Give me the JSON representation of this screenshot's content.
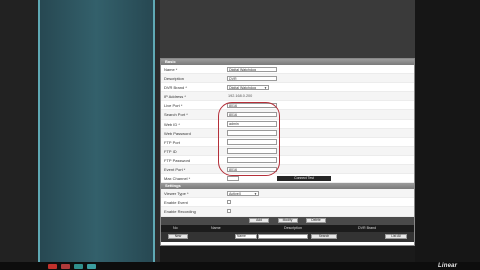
{
  "colors": {
    "sidebar": "#33606b",
    "highlight": "#b5303a",
    "section_header": "#8a8a8a"
  },
  "section_basic": {
    "title": "Basic",
    "fields": [
      {
        "label": "Name *",
        "value": "Digital Watchdog",
        "type": "text"
      },
      {
        "label": "Description",
        "value": "DVR",
        "type": "text"
      },
      {
        "label": "DVR Brand *",
        "value": "Digital Watchdog",
        "type": "select"
      },
      {
        "label": "IP Address *",
        "value": "192.168.0.200",
        "type": "plain"
      },
      {
        "label": "Live Port *",
        "value": "8016",
        "type": "text"
      },
      {
        "label": "Search Port *",
        "value": "8016",
        "type": "text"
      },
      {
        "label": "Web ID *",
        "value": "admin",
        "type": "text"
      },
      {
        "label": "Web Password",
        "value": "",
        "type": "text"
      },
      {
        "label": "FTP Port",
        "value": "",
        "type": "text"
      },
      {
        "label": "FTP ID",
        "value": "",
        "type": "text"
      },
      {
        "label": "FTP Password",
        "value": "",
        "type": "text"
      },
      {
        "label": "Event Port *",
        "value": "8016",
        "type": "text"
      },
      {
        "label": "Max Channel *",
        "value": "",
        "type": "command"
      }
    ],
    "command_button": "Connect Test"
  },
  "section_settings": {
    "title": "Settings",
    "viewer_type_label": "Viewer Type *",
    "viewer_type_value": "ActiveX",
    "enable_event_label": "Enable Event",
    "enable_recording_label": "Enable Recording"
  },
  "buttons": {
    "add": "Add",
    "modify": "Modify",
    "delete": "Delete"
  },
  "table": {
    "columns": [
      "No",
      "Name",
      "Description",
      "DVR Brand"
    ],
    "row_buttons": {
      "new": "New",
      "search": "Search",
      "list_all": "List All"
    },
    "filter_select": "Name"
  },
  "brand": {
    "logo": "Linear"
  },
  "taskbar_icons": [
    "lock-icon",
    "alert-icon",
    "display-icon",
    "refresh-icon"
  ]
}
